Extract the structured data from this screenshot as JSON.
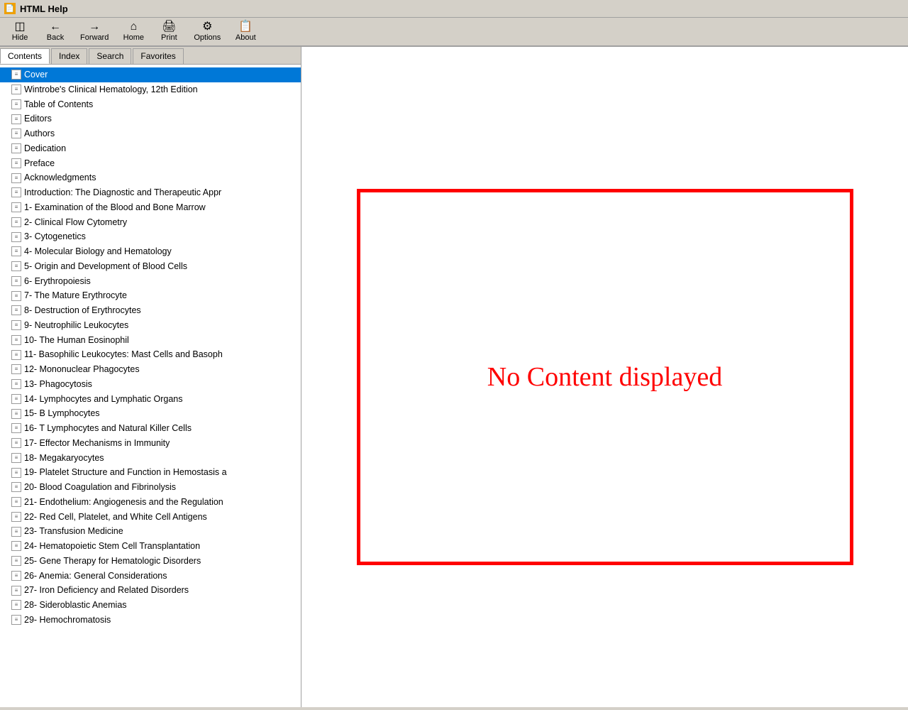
{
  "titlebar": {
    "icon": "📄",
    "title": "HTML Help"
  },
  "toolbar": {
    "buttons": [
      {
        "id": "hide",
        "icon": "◫",
        "label": "Hide"
      },
      {
        "id": "back",
        "icon": "←",
        "label": "Back"
      },
      {
        "id": "forward",
        "icon": "→",
        "label": "Forward"
      },
      {
        "id": "home",
        "icon": "⌂",
        "label": "Home"
      },
      {
        "id": "print",
        "icon": "🖨",
        "label": "Print"
      },
      {
        "id": "options",
        "icon": "⚙",
        "label": "Options"
      },
      {
        "id": "about",
        "icon": "📋",
        "label": "About"
      }
    ]
  },
  "tabs": [
    {
      "id": "contents",
      "label": "Contents",
      "active": true
    },
    {
      "id": "index",
      "label": "Index",
      "active": false
    },
    {
      "id": "search",
      "label": "Search",
      "active": false
    },
    {
      "id": "favorites",
      "label": "Favorites",
      "active": false
    }
  ],
  "treeItems": [
    {
      "id": "cover",
      "label": "Cover",
      "selected": true
    },
    {
      "id": "wintrobe",
      "label": "Wintrobe's Clinical Hematology, 12th Edition"
    },
    {
      "id": "toc",
      "label": "Table of Contents"
    },
    {
      "id": "editors",
      "label": "Editors"
    },
    {
      "id": "authors",
      "label": "Authors"
    },
    {
      "id": "dedication",
      "label": "Dedication"
    },
    {
      "id": "preface",
      "label": "Preface"
    },
    {
      "id": "acknowledgments",
      "label": "Acknowledgments"
    },
    {
      "id": "intro",
      "label": "Introduction: The Diagnostic and Therapeutic Appr"
    },
    {
      "id": "ch1",
      "label": "1- Examination of the Blood and Bone Marrow"
    },
    {
      "id": "ch2",
      "label": "2- Clinical Flow Cytometry"
    },
    {
      "id": "ch3",
      "label": "3- Cytogenetics"
    },
    {
      "id": "ch4",
      "label": "4- Molecular Biology and Hematology"
    },
    {
      "id": "ch5",
      "label": "5- Origin and Development of Blood Cells"
    },
    {
      "id": "ch6",
      "label": "6- Erythropoiesis"
    },
    {
      "id": "ch7",
      "label": "7- The Mature Erythrocyte"
    },
    {
      "id": "ch8",
      "label": "8- Destruction of Erythrocytes"
    },
    {
      "id": "ch9",
      "label": "9- Neutrophilic Leukocytes"
    },
    {
      "id": "ch10",
      "label": "10- The Human Eosinophil"
    },
    {
      "id": "ch11",
      "label": "11- Basophilic Leukocytes: Mast Cells and Basoph"
    },
    {
      "id": "ch12",
      "label": "12- Mononuclear Phagocytes"
    },
    {
      "id": "ch13",
      "label": "13- Phagocytosis"
    },
    {
      "id": "ch14",
      "label": "14- Lymphocytes and Lymphatic Organs"
    },
    {
      "id": "ch15",
      "label": "15- B Lymphocytes"
    },
    {
      "id": "ch16",
      "label": "16- T Lymphocytes and Natural Killer Cells"
    },
    {
      "id": "ch17",
      "label": "17- Effector Mechanisms in Immunity"
    },
    {
      "id": "ch18",
      "label": "18- Megakaryocytes"
    },
    {
      "id": "ch19",
      "label": "19- Platelet Structure and Function in Hemostasis a"
    },
    {
      "id": "ch20",
      "label": "20- Blood Coagulation and Fibrinolysis"
    },
    {
      "id": "ch21",
      "label": "21- Endothelium: Angiogenesis and the Regulation"
    },
    {
      "id": "ch22",
      "label": "22- Red Cell, Platelet, and White Cell Antigens"
    },
    {
      "id": "ch23",
      "label": "23- Transfusion Medicine"
    },
    {
      "id": "ch24",
      "label": "24- Hematopoietic Stem Cell Transplantation"
    },
    {
      "id": "ch25",
      "label": "25- Gene Therapy for Hematologic Disorders"
    },
    {
      "id": "ch26",
      "label": "26- Anemia: General Considerations"
    },
    {
      "id": "ch27",
      "label": "27- Iron Deficiency and Related Disorders"
    },
    {
      "id": "ch28",
      "label": "28- Sideroblastic Anemias"
    },
    {
      "id": "ch29",
      "label": "29- Hemochromatosis"
    }
  ],
  "noContent": {
    "text": "No Content displayed"
  }
}
